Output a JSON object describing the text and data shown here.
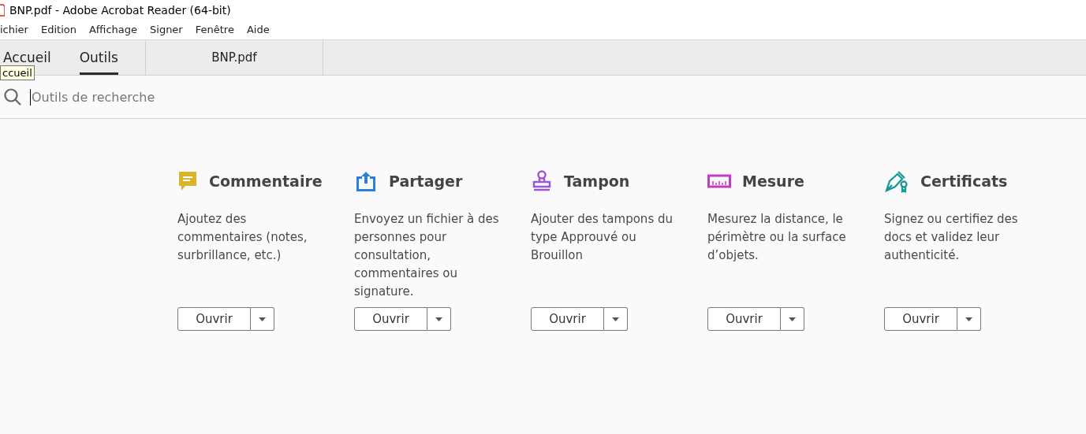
{
  "window": {
    "title": "BNP.pdf - Adobe Acrobat Reader (64-bit)"
  },
  "menu": [
    "ichier",
    "Edition",
    "Affichage",
    "Signer",
    "Fenêtre",
    "Aide"
  ],
  "tabs": [
    {
      "label": "Accueil",
      "selected": false
    },
    {
      "label": "Outils",
      "selected": true
    }
  ],
  "document_tab": {
    "label": "BNP.pdf"
  },
  "tooltip": "ccueil",
  "search": {
    "placeholder": "Outils de recherche"
  },
  "tools": [
    {
      "kind": "comment",
      "title": "Commentaire",
      "description": "Ajoutez des commentaires (notes, surbrillance, etc.)",
      "button": "Ouvrir"
    },
    {
      "kind": "share",
      "title": "Partager",
      "description": "Envoyez un fichier à des personnes pour consultation, commentaires ou signature.",
      "button": "Ouvrir"
    },
    {
      "kind": "stamp",
      "title": "Tampon",
      "description": "Ajouter des tampons du type Approuvé ou Brouillon",
      "button": "Ouvrir"
    },
    {
      "kind": "measure",
      "title": "Mesure",
      "description": "Mesurez la distance, le périmètre ou la surface d’objets.",
      "button": "Ouvrir"
    },
    {
      "kind": "certificate",
      "title": "Certificats",
      "description": "Signez ou certifiez des docs et validez leur authenticité.",
      "button": "Ouvrir"
    }
  ]
}
